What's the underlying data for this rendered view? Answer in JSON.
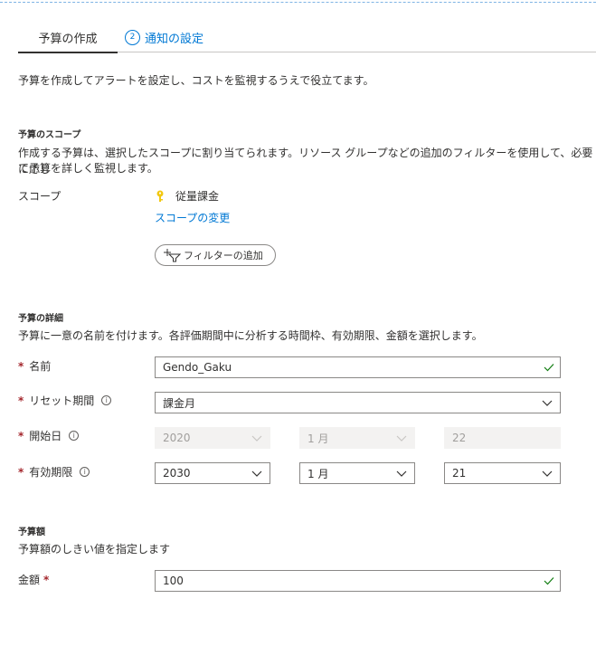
{
  "tabs": [
    {
      "label": "予算の作成",
      "active": true
    },
    {
      "label": "通知の設定",
      "step": "2"
    }
  ],
  "intro": "予算を作成してアラートを設定し、コストを監視するうえで役立てます。",
  "scope_section": {
    "title": "予算のスコープ",
    "description_line1": "作成する予算は、選択したスコープに割り当てられます。リソース グループなどの追加のフィルターを使用して、必要に応じ",
    "description_line2": "て予算を詳しく監視します。",
    "scope_label": "スコープ",
    "scope_value": "従量課金",
    "change_scope_link": "スコープの変更",
    "add_filter_button": "フィルターの追加"
  },
  "details_section": {
    "title": "予算の詳細",
    "description": "予算に一意の名前を付けます。各評価期間中に分析する時間枠、有効期限、金額を選択します。",
    "name_label": "名前",
    "name_value": "Gendo_Gaku",
    "reset_label": "リセット期間",
    "reset_value": "課金月",
    "start_label": "開始日",
    "start_year": "2020",
    "start_month": "1 月",
    "start_day": "22",
    "expire_label": "有効期限",
    "expire_year": "2030",
    "expire_month": "1 月",
    "expire_day": "21"
  },
  "amount_section": {
    "title": "予算額",
    "description": "予算額のしきい値を指定します",
    "amount_label": "金額",
    "amount_value": "100"
  },
  "required_mark": "*",
  "info_glyph": "i",
  "colors": {
    "accent": "#0078d4",
    "required": "#a4262c",
    "valid": "#107c10"
  }
}
